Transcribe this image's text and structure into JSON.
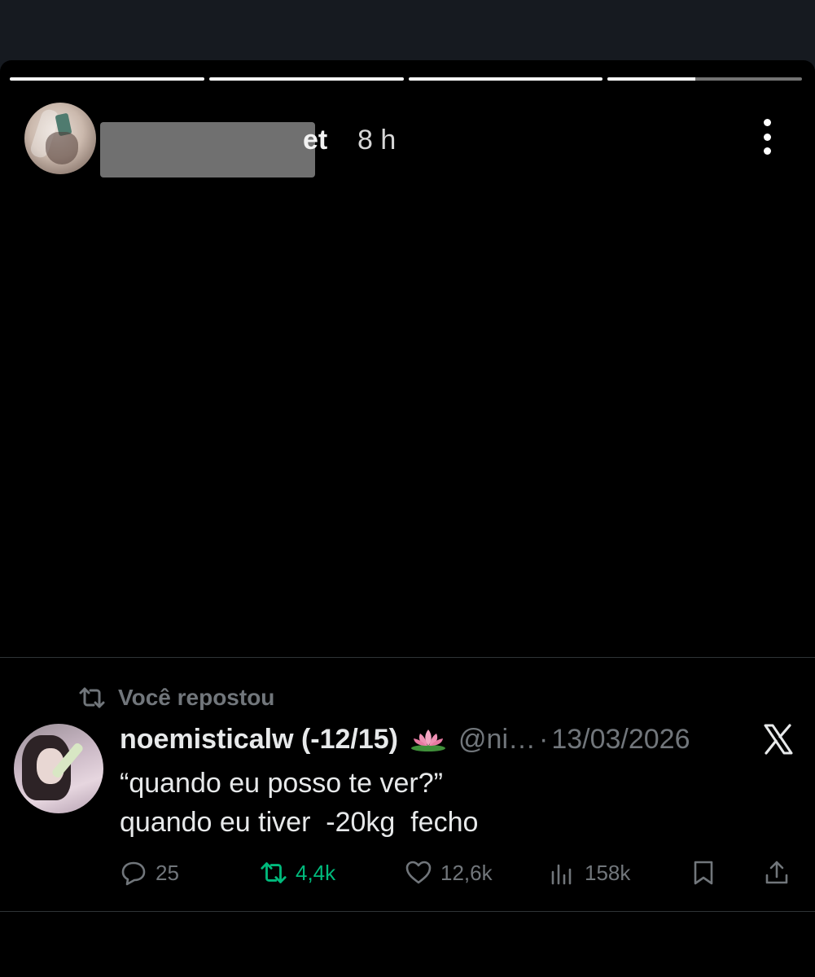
{
  "story": {
    "progress": [
      1,
      1,
      1,
      0.45
    ],
    "username_visible_suffix": "et",
    "time": "8 h"
  },
  "tweet": {
    "repost_label": "Você repostou",
    "author_name": "noemisticalw (-12/15)",
    "emoji_icon": "lotus-icon",
    "handle": "@ni…",
    "separator": "·",
    "date": "13/03/2026",
    "text_line1": "“quando eu posso te ver?”",
    "text_line2": "quando eu tiver  -20kg  fecho",
    "stats": {
      "replies": "25",
      "reposts": "4,4k",
      "likes": "12,6k",
      "views": "158k"
    }
  },
  "colors": {
    "background": "#000000",
    "secondary_text": "#71767b",
    "repost_green": "#00ba7c",
    "divider": "#2f3336"
  }
}
